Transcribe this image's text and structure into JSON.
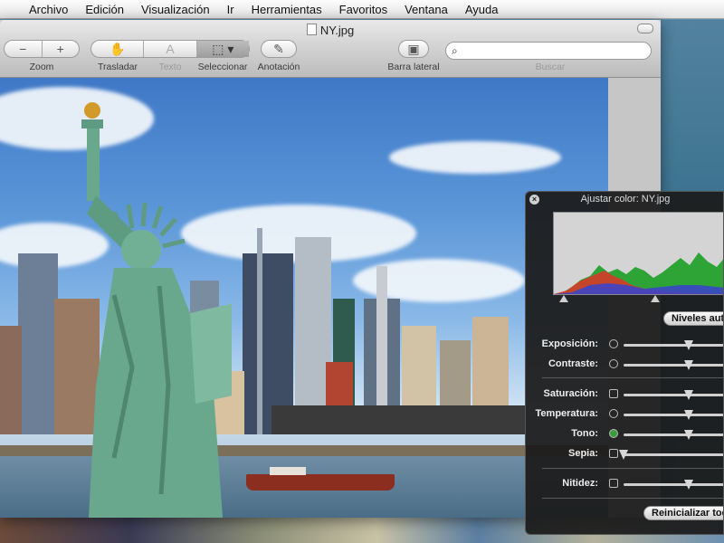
{
  "menubar": {
    "apple": "",
    "items": [
      "Archivo",
      "Edición",
      "Visualización",
      "Ir",
      "Herramientas",
      "Favoritos",
      "Ventana",
      "Ayuda"
    ]
  },
  "window": {
    "title": "NY.jpg",
    "toolbar": {
      "zoom": {
        "out": "−",
        "in": "+",
        "label": "Zoom"
      },
      "tools": {
        "move": "✋",
        "text": "A",
        "select": "⬚ ▾"
      },
      "labels": {
        "move": "Trasladar",
        "text": "Texto",
        "select": "Seleccionar"
      },
      "annotate": {
        "icon": "✎",
        "label": "Anotación"
      },
      "sidebar": {
        "icon": "▣",
        "label": "Barra lateral"
      },
      "search": {
        "placeholder": "",
        "label": "Buscar"
      }
    }
  },
  "panel": {
    "title": "Ajustar color: NY.jpg",
    "auto_levels": "Niveles autom",
    "rows": [
      {
        "label": "Exposición:",
        "icon": "exposure-icon",
        "value": 0.6
      },
      {
        "label": "Contraste:",
        "icon": "contrast-icon",
        "value": 0.6
      },
      {
        "label": "Saturación:",
        "icon": "saturation-icon",
        "value": 0.6
      },
      {
        "label": "Temperatura:",
        "icon": "temperature-icon",
        "value": 0.6
      },
      {
        "label": "Tono:",
        "icon": "tint-icon",
        "value": 0.6
      },
      {
        "label": "Sepia:",
        "icon": "sepia-icon",
        "value": 0.0
      },
      {
        "label": "Nitidez:",
        "icon": "sharpness-icon",
        "value": 0.6
      }
    ],
    "reset": "Reinicializar todo"
  }
}
